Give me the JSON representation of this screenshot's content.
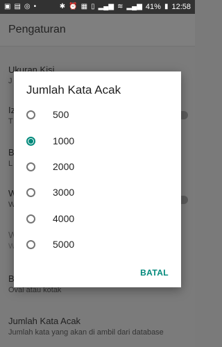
{
  "status_bar": {
    "battery": "41%",
    "time": "12:58",
    "left_icons": [
      "image-icon",
      "message-icon",
      "whatsapp-icon",
      "dot-icon"
    ],
    "right_icons": [
      "bluetooth-icon",
      "alarm-icon",
      "nfc-icon",
      "vibrate-icon",
      "signal-icon",
      "wifi-icon",
      "signal2-icon",
      "battery-icon"
    ]
  },
  "toolbar": {
    "title": "Pengaturan"
  },
  "preferences": [
    {
      "title": "Ukuran Kisi",
      "summary": "J"
    },
    {
      "title": "Iz",
      "summary": "T"
    },
    {
      "title": "B",
      "summary": "L"
    },
    {
      "title": "W",
      "summary": "W"
    },
    {
      "title": "W",
      "summary": "W"
    },
    {
      "title": "B",
      "summary": "Oval atau kotak"
    },
    {
      "title": "Jumlah Kata Acak",
      "summary": "Jumlah kata yang akan di ambil dari database"
    }
  ],
  "dialog": {
    "title": "Jumlah Kata Acak",
    "options": [
      {
        "label": "500",
        "selected": false
      },
      {
        "label": "1000",
        "selected": true
      },
      {
        "label": "2000",
        "selected": false
      },
      {
        "label": "3000",
        "selected": false
      },
      {
        "label": "4000",
        "selected": false
      },
      {
        "label": "5000",
        "selected": false
      }
    ],
    "cancel_label": "BATAL"
  },
  "colors": {
    "accent": "#00897b",
    "scrim": "#7b7b7b"
  }
}
